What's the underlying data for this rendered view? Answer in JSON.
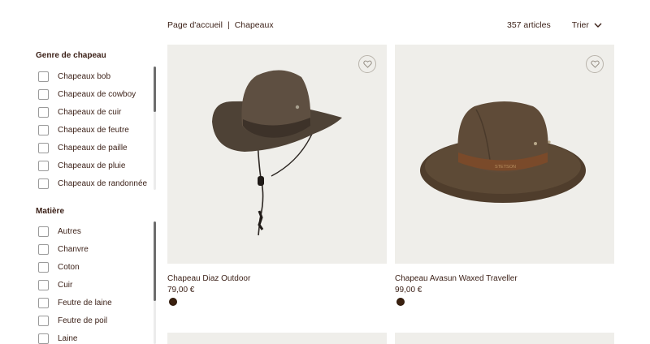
{
  "breadcrumb": {
    "home": "Page d'accueil",
    "separator": "|",
    "current": "Chapeaux"
  },
  "results": {
    "count_label": "357 articles",
    "sort_label": "Trier"
  },
  "filters": [
    {
      "title": "Genre de chapeau",
      "items": [
        "Chapeaux bob",
        "Chapeaux de cowboy",
        "Chapeaux de cuir",
        "Chapeaux de feutre",
        "Chapeaux de paille",
        "Chapeaux de pluie",
        "Chapeaux de randonnée"
      ]
    },
    {
      "title": "Matière",
      "items": [
        "Autres",
        "Chanvre",
        "Coton",
        "Cuir",
        "Feutre de laine",
        "Feutre de poil",
        "Laine"
      ]
    }
  ],
  "products": [
    {
      "name": "Chapeau Diaz Outdoor",
      "price": "79,00 €",
      "swatch_color": "#3b210f",
      "favorite_icon": "heart-icon"
    },
    {
      "name": "Chapeau Avasun Waxed Traveller",
      "price": "99,00 €",
      "swatch_color": "#3b210f",
      "favorite_icon": "heart-icon"
    }
  ],
  "colors": {
    "text": "#3a1f16",
    "image_background": "#efeeea",
    "hat_brown": "#5a4738"
  }
}
